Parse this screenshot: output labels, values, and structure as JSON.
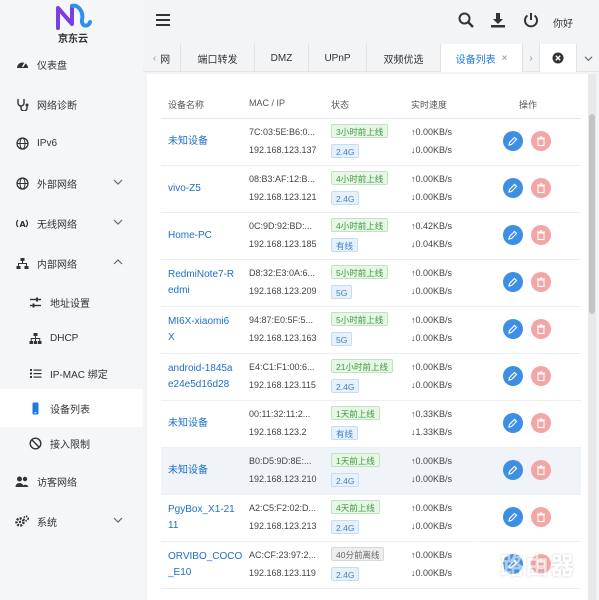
{
  "brand": {
    "logo_text": "京东云"
  },
  "topbar": {
    "greeting": "你好"
  },
  "sidebar": {
    "items": [
      {
        "label": "仪表盘",
        "icon": "dashboard-icon"
      },
      {
        "label": "网络诊断",
        "icon": "stethoscope-icon"
      },
      {
        "label": "IPv6",
        "icon": "globe-icon"
      },
      {
        "label": "外部网络",
        "icon": "globe-icon"
      },
      {
        "label": "无线网络",
        "icon": "wifi-icon"
      },
      {
        "label": "内部网络",
        "icon": "network-icon"
      },
      {
        "label": "地址设置",
        "icon": "sliders-icon"
      },
      {
        "label": "DHCP",
        "icon": "sitemap-icon"
      },
      {
        "label": "IP-MAC 绑定",
        "icon": "list-icon"
      },
      {
        "label": "设备列表",
        "icon": "mobile-icon"
      },
      {
        "label": "接入限制",
        "icon": "ban-icon"
      },
      {
        "label": "访客网络",
        "icon": "users-icon"
      },
      {
        "label": "系统",
        "icon": "gears-icon"
      }
    ]
  },
  "tabs": [
    {
      "label": "网"
    },
    {
      "label": "端口转发"
    },
    {
      "label": "DMZ"
    },
    {
      "label": "UPnP"
    },
    {
      "label": "双频优选"
    },
    {
      "label": "设备列表",
      "active": true
    }
  ],
  "table": {
    "headers": {
      "name": "设备名称",
      "mac_ip": "MAC / IP",
      "status": "状态",
      "speed": "实时速度",
      "actions": "操作"
    },
    "rows": [
      {
        "name": "未知设备",
        "mac": "7C:03:5E:B6:0...",
        "ip": "192.168.123.137",
        "time": "3小时前上线",
        "net": "2.4G",
        "up": "↑0.00KB/s",
        "down": "↓0.00KB/s"
      },
      {
        "name": "vivo-Z5",
        "mac": "08:B3:AF:12:B...",
        "ip": "192.168.123.121",
        "time": "4小时前上线",
        "net": "2.4G",
        "up": "↑0.00KB/s",
        "down": "↓0.00KB/s"
      },
      {
        "name": "Home-PC",
        "mac": "0C:9D:92:BD:...",
        "ip": "192.168.123.185",
        "time": "4小时前上线",
        "net": "有线",
        "up": "↑0.42KB/s",
        "down": "↓0.04KB/s"
      },
      {
        "name": "RedmiNote7-Redmi",
        "name_l1": "RedmiNote7-R",
        "name_l2": "edmi",
        "mac": "D8:32:E3:0A:6...",
        "ip": "192.168.123.209",
        "time": "5小时前上线",
        "net": "5G",
        "up": "↑0.00KB/s",
        "down": "↓0.00KB/s"
      },
      {
        "name": "MI6X-xiaomi6X",
        "name_l1": "MI6X-xiaomi6",
        "name_l2": "X",
        "mac": "94:87:E0:5F:5...",
        "ip": "192.168.123.163",
        "time": "5小时前上线",
        "net": "5G",
        "up": "↑0.00KB/s",
        "down": "↓0.00KB/s"
      },
      {
        "name": "android-1845ae24e5d16d28",
        "name_l1": "android-1845a",
        "name_l2": "e24e5d16d28",
        "mac": "E4:C1:F1:00:6...",
        "ip": "192.168.123.115",
        "time": "21小时前上线",
        "net": "2.4G",
        "up": "↑0.00KB/s",
        "down": "↓0.00KB/s"
      },
      {
        "name": "未知设备",
        "mac": "00:11:32:11:2...",
        "ip": "192.168.123.2",
        "time": "1天前上线",
        "net": "有线",
        "up": "↑0.33KB/s",
        "down": "↓1.33KB/s"
      },
      {
        "name": "未知设备",
        "mac": "B0:D5:9D:8E:...",
        "ip": "192.168.123.210",
        "time": "1天前上线",
        "net": "2.4G",
        "up": "↑0.00KB/s",
        "down": "↓0.00KB/s"
      },
      {
        "name": "PgyBox_X1-2111",
        "name_l1": "PgyBox_X1-21",
        "name_l2": "11",
        "mac": "A2:C5:F2:02:D...",
        "ip": "192.168.123.213",
        "time": "4天前上线",
        "net": "2.4G",
        "up": "↑0.00KB/s",
        "down": "↓0.00KB/s"
      },
      {
        "name": "ORVIBO_COCO_E10",
        "name_l1": "ORVIBO_COCO",
        "name_l2": "_E10",
        "mac": "AC:CF:23:97:2...",
        "ip": "192.168.123.119",
        "time": "40分前离线",
        "net": "2.4G",
        "up": "↑0.00KB/s",
        "down": "↓0.00KB/s"
      }
    ]
  },
  "watermark": {
    "text": "路由器"
  },
  "colors": {
    "accent": "#1f7ae0",
    "online": "#3a9a3a",
    "edit": "#3d8fe3",
    "delete": "#f2a6a6"
  }
}
